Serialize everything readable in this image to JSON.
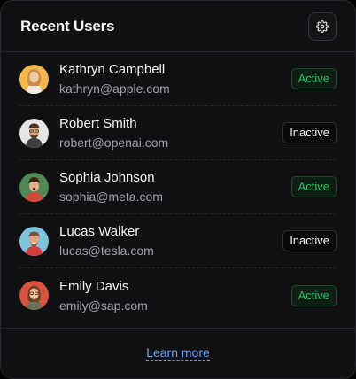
{
  "header": {
    "title": "Recent Users",
    "settings_icon": "gear-icon"
  },
  "users": [
    {
      "name": "Kathryn Campbell",
      "email": "kathryn@apple.com",
      "status": "Active"
    },
    {
      "name": "Robert Smith",
      "email": "robert@openai.com",
      "status": "Inactive"
    },
    {
      "name": "Sophia Johnson",
      "email": "sophia@meta.com",
      "status": "Active"
    },
    {
      "name": "Lucas Walker",
      "email": "lucas@tesla.com",
      "status": "Inactive"
    },
    {
      "name": "Emily Davis",
      "email": "emily@sap.com",
      "status": "Active"
    }
  ],
  "footer": {
    "link_label": "Learn more"
  },
  "colors": {
    "active": "#22c55e",
    "link": "#60a5fa",
    "background": "#101012"
  }
}
